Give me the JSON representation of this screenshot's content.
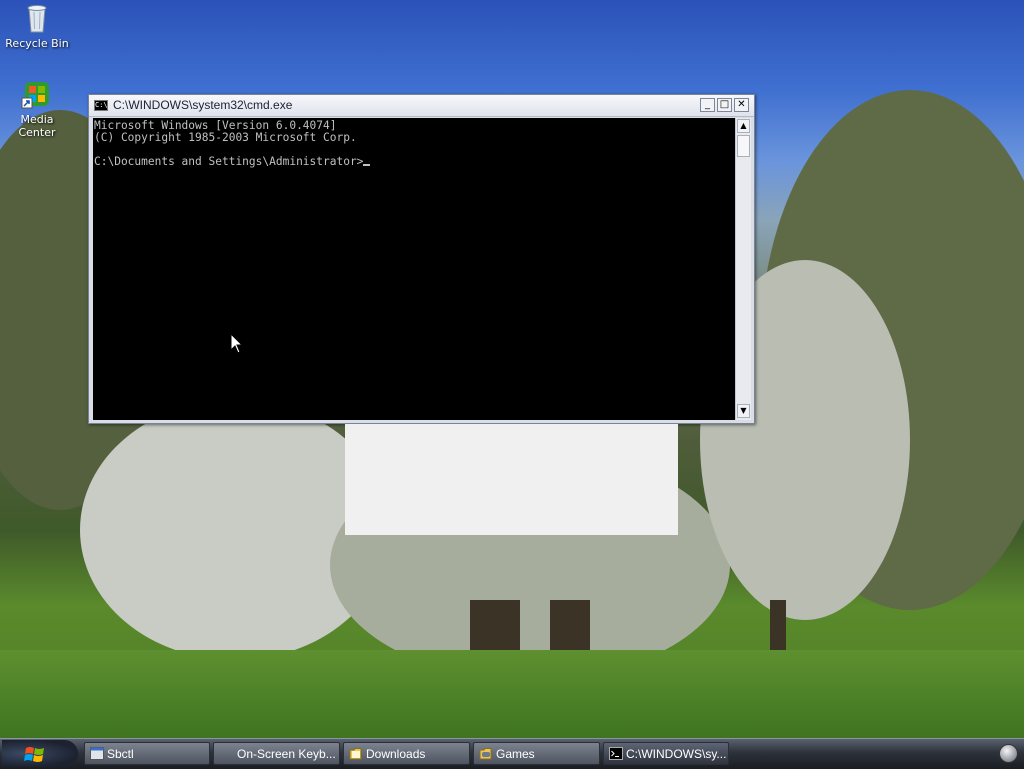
{
  "desktop": {
    "icons": [
      {
        "label": "Recycle Bin",
        "icon": "recycle-bin-icon"
      },
      {
        "label": "Media Center",
        "icon": "media-center-icon"
      }
    ]
  },
  "cmd_window": {
    "title": "C:\\WINDOWS\\system32\\cmd.exe",
    "icon": "command-prompt-icon",
    "console_lines": [
      "Microsoft Windows [Version 6.0.4074]",
      "(C) Copyright 1985-2003 Microsoft Corp.",
      "",
      "C:\\Documents and Settings\\Administrator>"
    ],
    "minimize_glyph": "_",
    "maximize_glyph": "□",
    "close_glyph": "✕"
  },
  "taskbar": {
    "start_icon": "windows-logo-icon",
    "buttons": [
      {
        "label": "Sbctl",
        "icon": "window-icon"
      },
      {
        "label": "On-Screen Keyb...",
        "icon": ""
      },
      {
        "label": "Downloads",
        "icon": "folder-icon"
      },
      {
        "label": "Games",
        "icon": "games-folder-icon"
      },
      {
        "label": "C:\\WINDOWS\\sy...",
        "icon": "command-prompt-icon"
      }
    ],
    "tray_icon": "notification-orb-icon"
  },
  "colors": {
    "console_background": "#000000",
    "console_text": "#c0c0c0",
    "taskbar": "#2d323b",
    "sky": "#3f6fd0",
    "grass": "#4c7d22"
  }
}
